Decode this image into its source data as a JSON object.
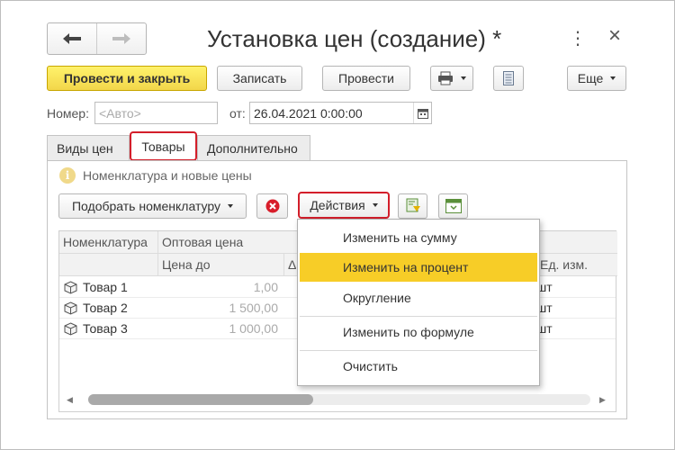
{
  "window": {
    "title": "Установка цен (создание) *",
    "more_icon": "⋮",
    "close_icon": "×"
  },
  "toolbar": {
    "post_close": "Провести и закрыть",
    "save": "Записать",
    "post": "Провести",
    "more": "Еще"
  },
  "form": {
    "number_label": "Номер:",
    "number_placeholder": "<Авто>",
    "date_label": "от:",
    "date_value": "26.04.2021  0:00:00"
  },
  "tabs": [
    "Виды цен",
    "Товары",
    "Дополнительно"
  ],
  "info_text": "Номенклатура и новые цены",
  "table_toolbar": {
    "pick": "Подобрать номенклатуру",
    "actions": "Действия"
  },
  "grid": {
    "col_nomenclature": "Номенклатура",
    "group_wholesale": "Оптовая цена",
    "col_price_before": "Цена до",
    "col_delta": "Δ",
    "col_unit": "Ед. изм.",
    "rows": [
      {
        "name": "Товар 1",
        "price": "1,00",
        "unit": "шт"
      },
      {
        "name": "Товар 2",
        "price": "1 500,00",
        "unit": "шт"
      },
      {
        "name": "Товар 3",
        "price": "1 000,00",
        "unit": "шт"
      }
    ]
  },
  "menu": {
    "items": [
      "Изменить на сумму",
      "Изменить на процент",
      "Округление",
      "Изменить по формуле",
      "Очистить"
    ]
  },
  "colors": {
    "accent_yellow": "#f2d64a",
    "highlight": "#f7cd27",
    "red_outline": "#d31e2a"
  }
}
